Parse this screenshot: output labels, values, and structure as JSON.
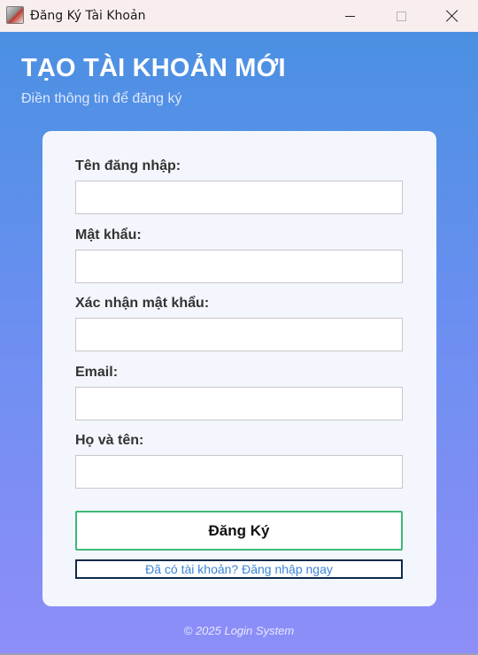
{
  "window": {
    "title": "Đăng Ký Tài Khoản"
  },
  "header": {
    "title": "TẠO TÀI KHOẢN MỚI",
    "subtitle": "Điền thông tin để đăng ký"
  },
  "form": {
    "fields": [
      {
        "label": "Tên đăng nhập:",
        "value": "",
        "placeholder": ""
      },
      {
        "label": "Mật khẩu:",
        "value": "",
        "placeholder": ""
      },
      {
        "label": "Xác nhận mật khẩu:",
        "value": "",
        "placeholder": ""
      },
      {
        "label": "Email:",
        "value": "",
        "placeholder": ""
      },
      {
        "label": "Họ và tên:",
        "value": "",
        "placeholder": ""
      }
    ],
    "submit_label": "Đăng Ký",
    "login_link": "Đã có tài khoản? Đăng nhập ngay"
  },
  "footer": {
    "text": "© 2025 Login System"
  },
  "colors": {
    "gradient_top": "#4a90e2",
    "gradient_bottom": "#8e8ef8",
    "button_border": "#3cb878",
    "link_text": "#3b82d6"
  },
  "icons": {
    "app": "app-icon",
    "minimize": "minimize-icon",
    "maximize": "maximize-icon",
    "close": "close-icon"
  }
}
